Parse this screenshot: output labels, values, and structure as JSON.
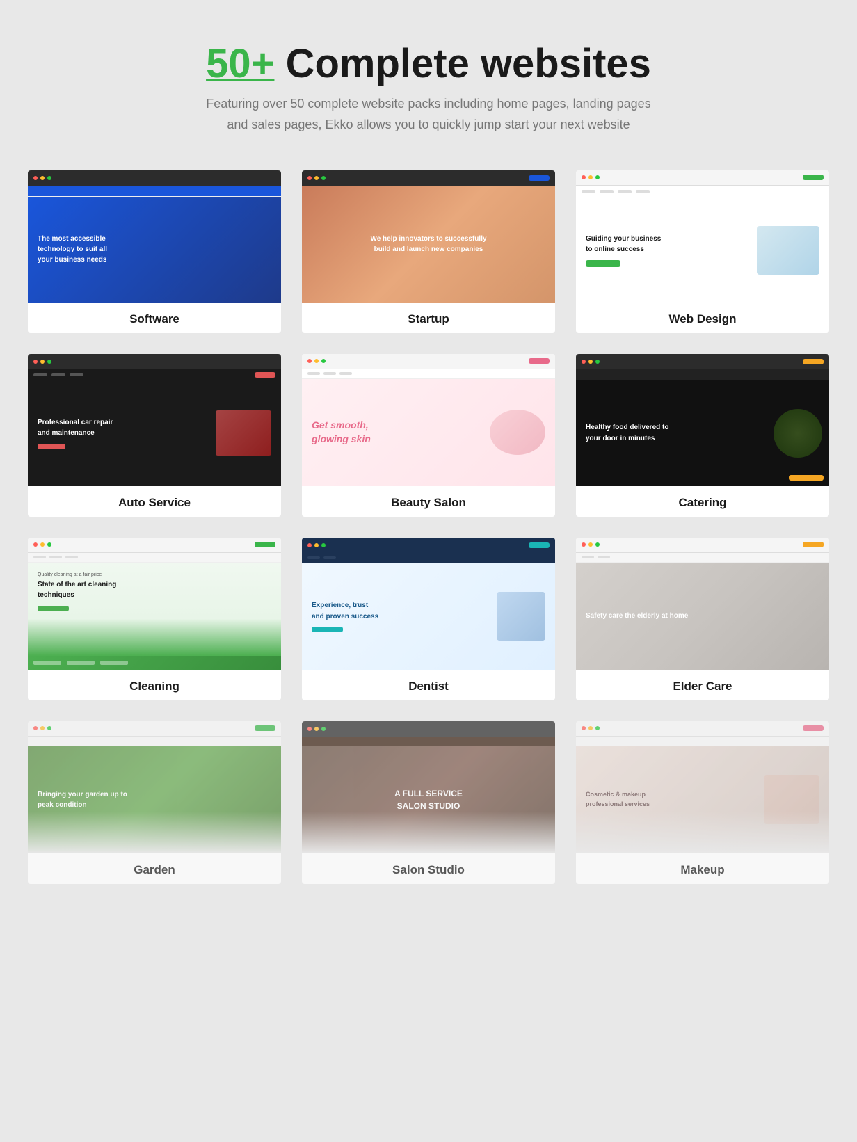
{
  "header": {
    "title_accent": "50+",
    "title_rest": " Complete websites",
    "subtitle": "Featuring over 50 complete website packs including home pages, landing pages and sales pages, Ekko allows you to quickly jump start your next website"
  },
  "cards": [
    {
      "id": "software",
      "label": "Software",
      "hero_text": "The most accessible technology to suit all your business needs",
      "theme": "blue"
    },
    {
      "id": "startup",
      "label": "Startup",
      "hero_text": "We help innovators to successfully build and launch new companies",
      "theme": "warm"
    },
    {
      "id": "webdesign",
      "label": "Web Design",
      "hero_text": "Guiding your business to online success",
      "theme": "light"
    },
    {
      "id": "auto",
      "label": "Auto Service",
      "hero_text": "Professional car repair and maintenance",
      "theme": "dark"
    },
    {
      "id": "beauty",
      "label": "Beauty Salon",
      "hero_text": "Get smooth, glowing skin",
      "theme": "pink"
    },
    {
      "id": "catering",
      "label": "Catering",
      "hero_text": "Healthy food delivered to your door in minutes",
      "theme": "black"
    },
    {
      "id": "cleaning",
      "label": "Cleaning",
      "hero_text": "State of the art cleaning techniques",
      "theme": "green"
    },
    {
      "id": "dentist",
      "label": "Dentist",
      "hero_text": "Experience, trust and proven success",
      "theme": "light-blue"
    },
    {
      "id": "eldercare",
      "label": "Elder Care",
      "hero_text": "Safety care the elderly at home",
      "theme": "gray"
    },
    {
      "id": "garden",
      "label": "Garden",
      "hero_text": "Bringing your garden up to peak condition",
      "theme": "nature"
    },
    {
      "id": "salon",
      "label": "Salon Studio",
      "hero_text": "A Full Service Salon Studio",
      "theme": "dark-brown"
    },
    {
      "id": "makeup",
      "label": "Makeup",
      "hero_text": "Cosmetic & makeup professional services",
      "theme": "nude"
    }
  ]
}
